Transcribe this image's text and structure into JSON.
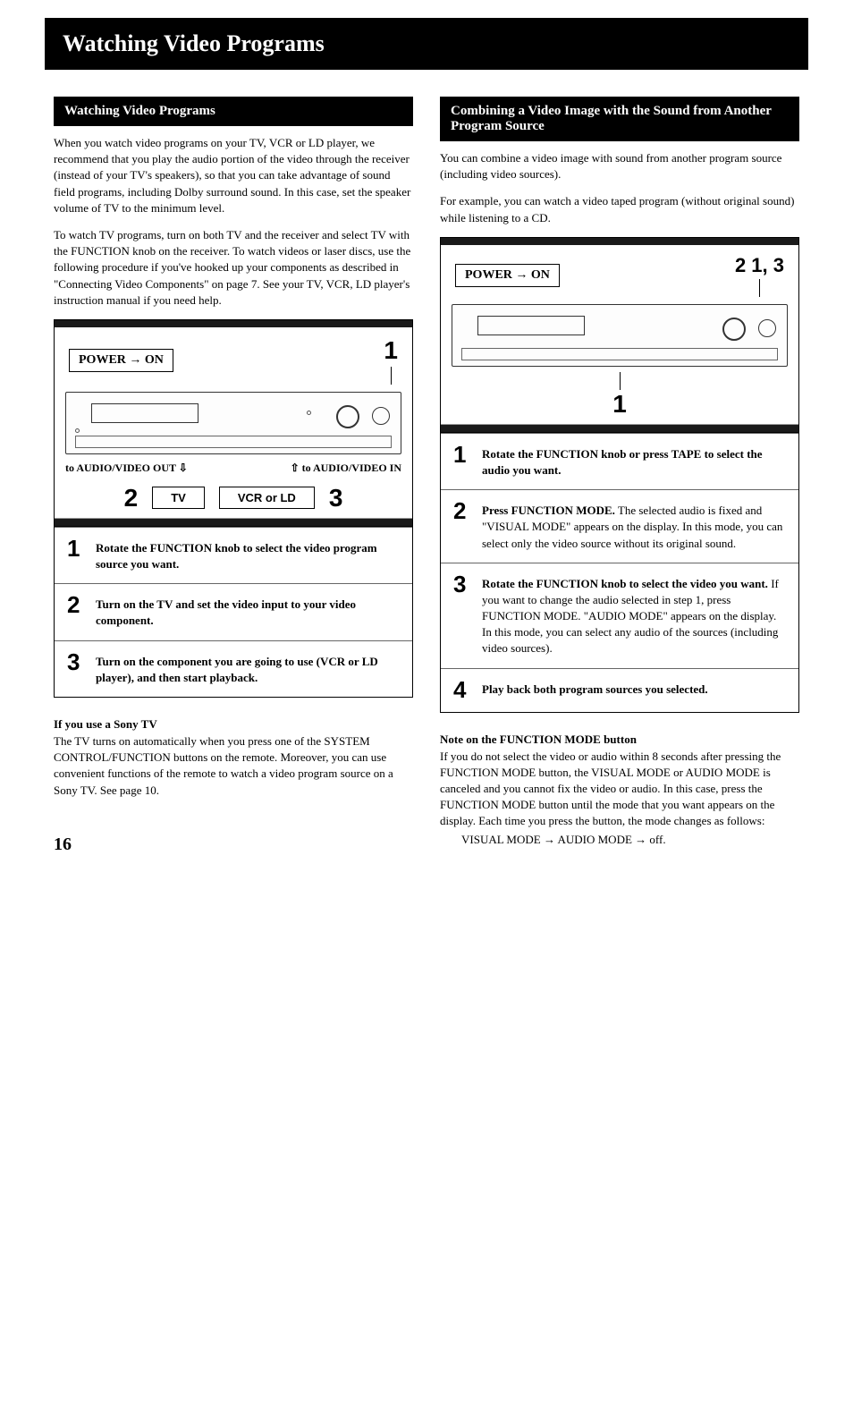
{
  "page_title": "Watching Video Programs",
  "page_number": "16",
  "left": {
    "section_title": "Watching Video Programs",
    "para1": "When you watch video programs on your TV, VCR or LD player, we recommend that you play the audio portion of the video through the receiver (instead of your TV's speakers), so that you can take advantage of sound field programs, including Dolby surround sound. In this case, set the speaker volume of TV to the minimum level.",
    "para2": "To watch TV programs, turn on both TV and the receiver and select TV with the FUNCTION knob on the receiver. To watch videos or laser discs, use the following procedure if you've hooked up your components as described in \"Connecting Video Components\" on page 7. See your TV, VCR, LD player's instruction manual if you need help.",
    "diagram": {
      "power_label": "POWER → ON",
      "callout_top": "1",
      "conn_out": "to AUDIO/VIDEO OUT",
      "conn_in": "to AUDIO/VIDEO IN",
      "callout_left": "2",
      "tv_label": "TV",
      "vcr_label": "VCR or LD",
      "callout_right": "3"
    },
    "steps": [
      {
        "num": "1",
        "bold": "Rotate the FUNCTION knob to select the video program source you want.",
        "rest": ""
      },
      {
        "num": "2",
        "bold": "Turn on the TV and set the video input to your video component.",
        "rest": ""
      },
      {
        "num": "3",
        "bold": "Turn on the component you are going to use (VCR or LD player), and then start playback.",
        "rest": ""
      }
    ],
    "note_heading": "If you use a Sony TV",
    "note_body": "The TV turns on automatically when you press one of the SYSTEM CONTROL/FUNCTION buttons on the remote. Moreover, you can use convenient functions of the remote to watch a video program source on a Sony TV. See page 10."
  },
  "right": {
    "section_title": "Combining a Video Image with the Sound from Another Program Source",
    "para1": "You can combine a video image with sound from another program source (including video sources).",
    "para2": "For example, you can watch a video taped program (without original sound) while listening to a CD.",
    "diagram": {
      "power_label": "POWER → ON",
      "callouts_top": "2  1, 3",
      "callout_bottom": "1"
    },
    "steps": [
      {
        "num": "1",
        "bold": "Rotate the FUNCTION knob or press TAPE to select the audio you want.",
        "rest": ""
      },
      {
        "num": "2",
        "bold": "Press FUNCTION MODE.",
        "rest": "The selected audio is fixed and \"VISUAL MODE\" appears on the display. In this mode, you can select only the video source without its original sound."
      },
      {
        "num": "3",
        "bold": "Rotate the FUNCTION knob to select the video you want.",
        "rest": "If you want to change the audio selected in step 1, press FUNCTION MODE. \"AUDIO MODE\" appears on the display. In this mode, you can select any audio of the sources (including video sources)."
      },
      {
        "num": "4",
        "bold": "Play back both program sources you selected.",
        "rest": ""
      }
    ],
    "note_heading": "Note on the FUNCTION MODE button",
    "note_body": "If you do not select the video or audio within 8 seconds after pressing the FUNCTION MODE button, the VISUAL MODE or AUDIO MODE is canceled and you cannot fix the video or audio. In this case, press the FUNCTION MODE button until the mode that you want appears on the display. Each time you press the button, the mode changes as follows:",
    "mode_sequence": "VISUAL MODE → AUDIO MODE → off."
  }
}
